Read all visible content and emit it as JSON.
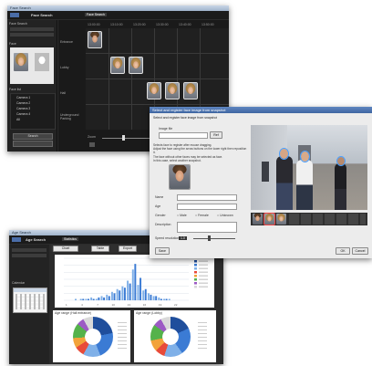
{
  "face_search": {
    "title": "Face Search",
    "menu_tab": "Face Search",
    "sidebar": {
      "section_detail": "Face Search",
      "section_face": "Face",
      "section_list": "Face list",
      "search_button": "Search",
      "options": [
        "Camera 1",
        "Camera 2",
        "Camera 3",
        "Camera 4",
        "All"
      ]
    },
    "timeline_headers": [
      "13:00:00",
      "13:10:00",
      "13:20:00",
      "13:30:00",
      "13:40:00",
      "13:50:00"
    ],
    "rows": [
      "Entrance",
      "Lobby",
      "Hall",
      "Underground Parking"
    ],
    "zoom_label": "Zoom"
  },
  "register": {
    "title": "Select and register face image from snapshot",
    "instruction": "Select and register face image from snapshot",
    "load_file_label": "Image file",
    "browse_button": "Ref",
    "description_lines": [
      "Selects face to register after mouse dragging.",
      "Adjust the face using the arrow buttons on the lower right then reposition it.",
      "The face without other faces may be selected as face.",
      "In this case, select another snapshot."
    ],
    "fields": [
      {
        "label": "Name",
        "value": ""
      },
      {
        "label": "Age",
        "value": ""
      },
      {
        "label": "Gender",
        "value": ""
      },
      {
        "label": "Description",
        "value": ""
      }
    ],
    "gender_options": [
      "Male",
      "Female",
      "Unknown"
    ],
    "speed_label": "Speed resolution",
    "speed_value": "1.0",
    "save_button": "Save",
    "ok_button": "OK",
    "cancel_button": "Cancel"
  },
  "stats": {
    "title": "Age Search",
    "tab_label": "Statistics",
    "toolbar": [
      "Chart",
      "Table",
      "Export"
    ],
    "calendar_label": "Calendar",
    "pie1_title": "Age range (Hall entrance)",
    "pie2_title": "Age range (Lobby)",
    "chart_data": {
      "type": "bar",
      "categories": [
        "1",
        "2",
        "3",
        "4",
        "5",
        "6",
        "7",
        "8",
        "9",
        "10",
        "11",
        "12",
        "13",
        "14",
        "15",
        "16",
        "17",
        "18",
        "19",
        "20",
        "21",
        "22",
        "23",
        "24"
      ],
      "series": [
        {
          "values": [
            0,
            0,
            1,
            1,
            1,
            2,
            1,
            3,
            4,
            6,
            8,
            10,
            14,
            22,
            11,
            7,
            5,
            3,
            2,
            1,
            1,
            0,
            0,
            0
          ]
        },
        {
          "values": [
            0,
            0,
            0,
            1,
            1,
            1,
            2,
            2,
            3,
            5,
            7,
            9,
            12,
            26,
            16,
            8,
            4,
            3,
            1,
            1,
            0,
            0,
            0,
            0
          ]
        }
      ],
      "ylim": [
        0,
        30
      ]
    },
    "pie_colors": [
      "#1f4e9c",
      "#3b7bd4",
      "#7fb0e8",
      "#e84b3a",
      "#f2a33a",
      "#55b24b",
      "#9c5ac4",
      "#d9d9d9"
    ]
  }
}
